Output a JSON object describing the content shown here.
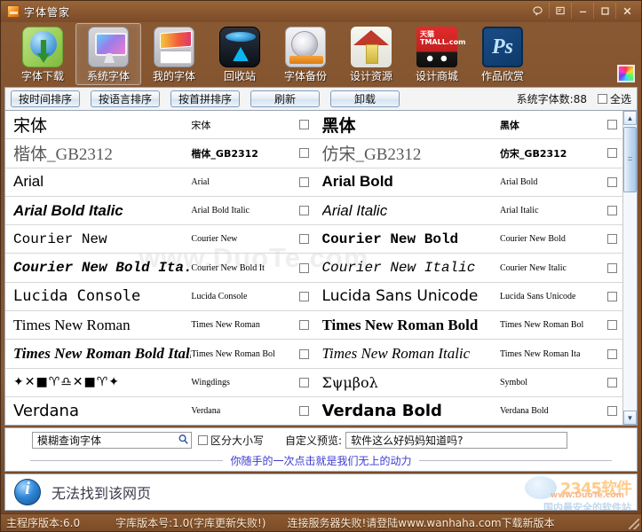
{
  "window": {
    "title": "字体管家",
    "app_icon": "font-manager-icon",
    "controls": [
      {
        "name": "help-balloon-button",
        "glyph": "help"
      },
      {
        "name": "feedback-button",
        "glyph": "feedback"
      },
      {
        "name": "minimize-button",
        "glyph": "minimize"
      },
      {
        "name": "maximize-button",
        "glyph": "maximize"
      },
      {
        "name": "close-button",
        "glyph": "close"
      }
    ]
  },
  "toolbar": {
    "items": [
      {
        "label": "字体下载",
        "icon": "font-download-icon",
        "selected": false
      },
      {
        "label": "系统字体",
        "icon": "system-font-icon",
        "selected": true
      },
      {
        "label": "我的字体",
        "icon": "my-font-icon",
        "selected": false
      },
      {
        "label": "回收站",
        "icon": "recycle-bin-icon",
        "selected": false
      },
      {
        "label": "字体备份",
        "icon": "font-backup-icon",
        "selected": false
      },
      {
        "label": "设计资源",
        "icon": "design-resource-icon",
        "selected": false
      },
      {
        "label": "设计商城",
        "icon": "design-mall-icon",
        "selected": false
      },
      {
        "label": "作品欣赏",
        "icon": "works-gallery-icon",
        "selected": false
      }
    ],
    "tmall_line1": "天猫",
    "tmall_line2": "TMALL.com",
    "ps_label": "Ps",
    "palette_icon": "color-palette-icon"
  },
  "sortbar": {
    "buttons": [
      {
        "label": "按时间排序",
        "name": "sort-by-time-button"
      },
      {
        "label": "按语言排序",
        "name": "sort-by-language-button"
      },
      {
        "label": "按首拼排序",
        "name": "sort-by-pinyin-button"
      },
      {
        "label": "刷新",
        "name": "refresh-button"
      },
      {
        "label": "卸载",
        "name": "uninstall-button"
      }
    ],
    "font_count_label": "系统字体数:88",
    "select_all_label": "全选"
  },
  "list": {
    "watermark": "www.DuoTe.com",
    "rows": [
      {
        "left": {
          "display": "宋体",
          "style": "f-song",
          "small": "宋体",
          "small_style": "sm-cn",
          "checked": false
        },
        "right": {
          "display": "黑体",
          "style": "f-hei",
          "small": "黑体",
          "small_style": "sm-cn f-heis",
          "checked": false
        }
      },
      {
        "left": {
          "display": "楷体_GB2312",
          "style": "f-kai",
          "small": "楷体_GB2312",
          "small_style": "sm-cn f-kais",
          "checked": false
        },
        "right": {
          "display": "仿宋_GB2312",
          "style": "f-kai",
          "small": "仿宋_GB2312",
          "small_style": "sm-cn f-kais",
          "checked": false
        }
      },
      {
        "left": {
          "display": "Arial",
          "style": "f-arial",
          "small": "Arial",
          "small_style": "sm-ser",
          "checked": false
        },
        "right": {
          "display": "Arial Bold",
          "style": "f-arialb",
          "small": "Arial Bold",
          "small_style": "sm-ser",
          "checked": false
        }
      },
      {
        "left": {
          "display": "Arial Bold Italic",
          "style": "f-abi",
          "small": "Arial Bold Italic",
          "small_style": "sm-ser",
          "checked": false
        },
        "right": {
          "display": "Arial Italic",
          "style": "f-ai",
          "small": "Arial Italic",
          "small_style": "sm-ser",
          "checked": false
        }
      },
      {
        "left": {
          "display": "Courier New",
          "style": "f-cour",
          "small": "Courier New",
          "small_style": "sm-ser",
          "checked": false
        },
        "right": {
          "display": "Courier New Bold",
          "style": "f-courb",
          "small": "Courier New Bold",
          "small_style": "sm-ser",
          "checked": false
        }
      },
      {
        "left": {
          "display": "Courier New Bold Ita.",
          "style": "f-courbi",
          "small": "Courier New Bold It",
          "small_style": "sm-ser",
          "checked": false
        },
        "right": {
          "display": "Courier New Italic",
          "style": "f-couri",
          "small": "Courier New Italic",
          "small_style": "sm-ser",
          "checked": false
        }
      },
      {
        "left": {
          "display": "Lucida Console",
          "style": "f-lucc",
          "small": "Lucida Console",
          "small_style": "sm-ser",
          "checked": false
        },
        "right": {
          "display": "Lucida Sans Unicode",
          "style": "f-lucs",
          "small": "Lucida Sans Unicode",
          "small_style": "sm-ser",
          "checked": false
        }
      },
      {
        "left": {
          "display": "Times New Roman",
          "style": "f-tnr",
          "small": "Times New Roman",
          "small_style": "sm-ser",
          "checked": false
        },
        "right": {
          "display": "Times New Roman Bold",
          "style": "f-tnrb",
          "small": "Times New Roman Bol",
          "small_style": "sm-ser",
          "checked": false
        }
      },
      {
        "left": {
          "display": "Times New Roman Bold Itali",
          "style": "f-tnrbi",
          "small": "Times New Roman Bol",
          "small_style": "sm-ser",
          "checked": false
        },
        "right": {
          "display": "Times New Roman Italic",
          "style": "f-tnri",
          "small": "Times New Roman Ita",
          "small_style": "sm-ser",
          "checked": false
        }
      },
      {
        "left": {
          "display": "✦✕■♈♎✕■♈✦",
          "style": "f-wing",
          "small": "Wingdings",
          "small_style": "sm-ser",
          "checked": false
        },
        "right": {
          "display": "Σψμβολ",
          "style": "f-sym",
          "small": "Symbol",
          "small_style": "sm-ser",
          "checked": false
        }
      },
      {
        "left": {
          "display": "Verdana",
          "style": "f-verd",
          "small": "Verdana",
          "small_style": "sm-ser",
          "checked": false
        },
        "right": {
          "display": "Verdana Bold",
          "style": "f-verdb",
          "small": "Verdana Bold",
          "small_style": "sm-ser",
          "checked": false
        }
      }
    ]
  },
  "search": {
    "value": "模糊查询字体",
    "search_icon": "search-icon",
    "case_sensitive_label": "区分大小写",
    "preview_label": "自定义预览:",
    "preview_value": "软件这么好妈妈知道吗?"
  },
  "promo": {
    "text": "你随手的一次点击就是我们无上的动力"
  },
  "info": {
    "icon": "info-icon",
    "message": "无法找到该网页",
    "watermark_main": "2345软件",
    "watermark_url": "www.DuoTe.com",
    "watermark_tag": "国内最安全的软件站"
  },
  "status": {
    "main_version": "主程序版本:6.0",
    "font_db_version": "字库版本号:1.0(字库更新失败!)",
    "server_message": "连接服务器失败!请登陆www.wanhaha.com下载新版本"
  }
}
